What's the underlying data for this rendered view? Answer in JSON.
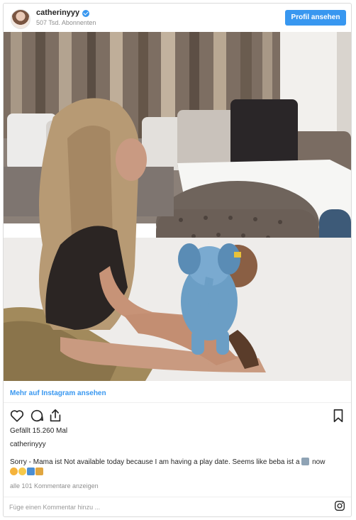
{
  "header": {
    "username": "catherinyyy",
    "followers": "507 Tsd. Abonnenten",
    "profile_button": "Profil ansehen"
  },
  "post": {
    "more_link": "Mehr auf Instagram ansehen",
    "likes": "Gefällt 15.260 Mal",
    "owner": "catherinyyy",
    "caption_owner": "Sorry",
    "caption_text": " - Mama ist Not available today because I am having a play date. Seems like beba ist a ",
    "caption_after_icon": " now",
    "view_comments": "alle 101 Kommentare anzeigen",
    "comment_placeholder": "Füge einen Kommentar hinzu ..."
  },
  "icons": {
    "like": "heart-icon",
    "comment": "speech-bubble-icon",
    "share": "share-icon",
    "save": "bookmark-icon",
    "instagram": "instagram-logo-icon",
    "verified": "verified-badge-icon"
  },
  "colors": {
    "accent": "#3897f0",
    "muted_text": "#8e8e8e",
    "border": "#dbdbdb"
  }
}
